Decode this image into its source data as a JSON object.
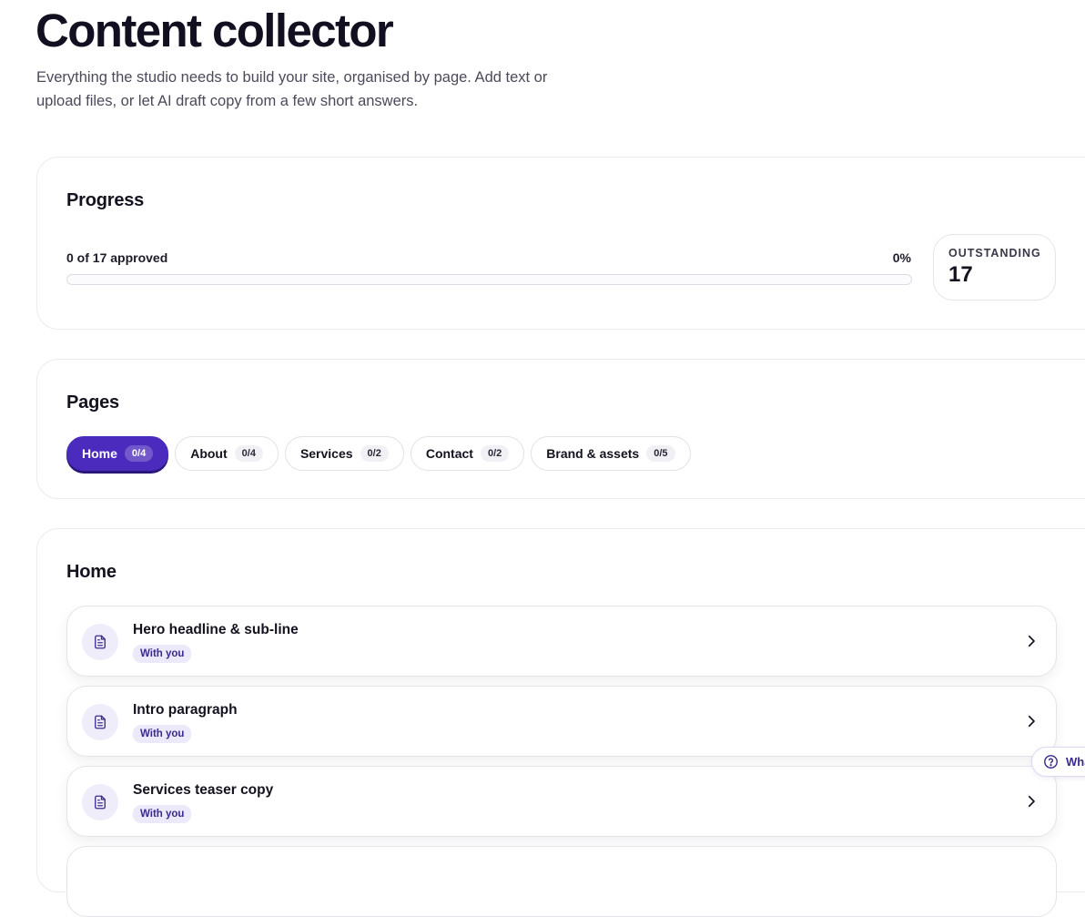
{
  "header": {
    "title": "Content collector",
    "subtitle": "Everything the studio needs to build your site, organised by page. Add text or upload files, or let AI draft copy from a few short answers."
  },
  "progress": {
    "heading": "Progress",
    "approved_text": "0 of 17 approved",
    "percent_text": "0%",
    "percent_value": 0,
    "outstanding_label": "OUTSTANDING",
    "outstanding_value": "17"
  },
  "pages": {
    "heading": "Pages",
    "tabs": [
      {
        "label": "Home",
        "count": "0/4",
        "active": true
      },
      {
        "label": "About",
        "count": "0/4",
        "active": false
      },
      {
        "label": "Services",
        "count": "0/2",
        "active": false
      },
      {
        "label": "Contact",
        "count": "0/2",
        "active": false
      },
      {
        "label": "Brand & assets",
        "count": "0/5",
        "active": false
      }
    ]
  },
  "home": {
    "heading": "Home",
    "items": [
      {
        "title": "Hero headline & sub-line",
        "status": "With you",
        "icon": "document-icon"
      },
      {
        "title": "Intro paragraph",
        "status": "With you",
        "icon": "document-icon"
      },
      {
        "title": "Services teaser copy",
        "status": "With you",
        "icon": "document-icon"
      }
    ]
  },
  "help": {
    "label": "Wha",
    "icon": "question-circle-icon"
  },
  "colors": {
    "accent": "#4b2bbd",
    "badge_bg": "#ece9fb",
    "icon_bg": "#efedfa"
  }
}
